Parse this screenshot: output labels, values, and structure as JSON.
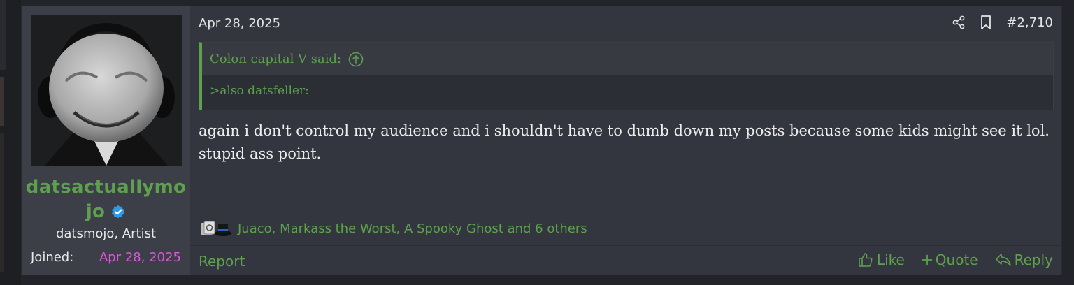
{
  "post": {
    "date": "Apr 28, 2025",
    "post_number": "#2,710",
    "user": {
      "name_line1": "datsactuallymo",
      "name_line2": "jo",
      "title": "datsmojo, Artist",
      "joined_label": "Joined:",
      "joined_value": "Apr 28, 2025"
    },
    "quote": {
      "author_said": "Colon capital V said:",
      "text": ">also datsfeller:"
    },
    "message": "again i don't control my audience and i shouldn't have to dumb down my posts because some kids might see it lol. stupid ass point.",
    "reactions_text": "Juaco, Markass the Worst, A Spooky Ghost and 6 others",
    "footer": {
      "report": "Report",
      "like": "Like",
      "quote": "Quote",
      "reply": "Reply"
    },
    "icons": [
      "share-icon",
      "bookmark-icon",
      "arrow-up-circle-icon",
      "verified-badge-icon",
      "like-icon",
      "plus-icon",
      "reply-icon"
    ],
    "colors": {
      "accent_green": "#5ea04e",
      "joined_date": "#d958d9",
      "verified_blue": "#2f9be8",
      "post_bg": "#33363e",
      "user_col_bg": "#3c3f48"
    }
  }
}
